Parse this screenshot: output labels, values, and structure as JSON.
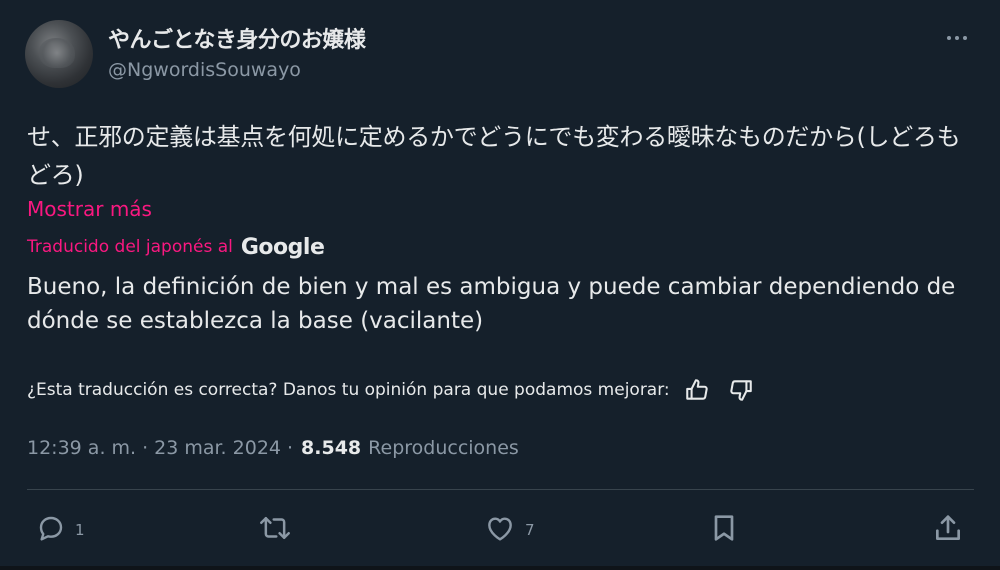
{
  "author": {
    "display_name": "やんごとなき身分のお嬢様",
    "handle": "@NgwordisSouwayo"
  },
  "post": {
    "original_text": "せ、正邪の定義は基点を何処に定めるかでどうにでも変わる曖昧なものだから(しどろもどろ)",
    "show_more_label": "Mostrar más",
    "translated_label": "Traducido del japonés al",
    "translator_brand": "Google",
    "translation_text": "Bueno, la definición de bien y mal es ambigua y puede cambiar dependiendo de dónde se establezca la base (vacilante)",
    "feedback_prompt": "¿Esta traducción es correcta? Danos tu opinión para que podamos mejorar:"
  },
  "meta": {
    "time": "12:39 a. m.",
    "separator": "·",
    "date": "23 mar. 2024",
    "views_count": "8.548",
    "views_label": "Reproducciones"
  },
  "actions": {
    "replies_count": "1",
    "likes_count": "7"
  },
  "colors": {
    "background": "#15202b",
    "text_primary": "#e7e9ea",
    "text_secondary": "#8b98a5",
    "accent_pink": "#f91880",
    "divider": "#38444d"
  },
  "icons": [
    "more-icon",
    "thumbs-up-icon",
    "thumbs-down-icon",
    "reply-icon",
    "repost-icon",
    "like-icon",
    "bookmark-icon",
    "share-icon"
  ]
}
